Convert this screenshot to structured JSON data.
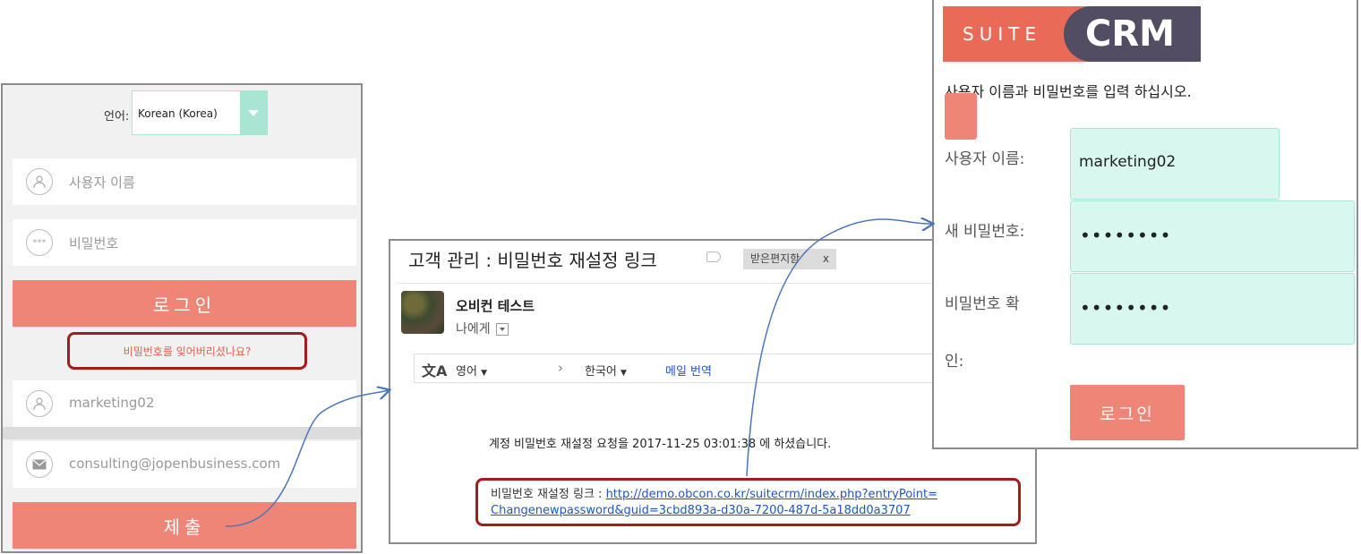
{
  "login": {
    "language_label": "언어:",
    "language_value": "Korean (Korea)",
    "username_placeholder": "사용자 이름",
    "password_placeholder": "비밀번호",
    "login_button": "로그인",
    "forgot_link": "비밀번호를 잊어버리셨나요?",
    "username_value": "marketing02",
    "email_value": "consulting@jopenbusiness.com",
    "submit_button": "제출",
    "icons": {
      "user": "user-icon",
      "password": "password-icon",
      "email": "envelope-icon"
    },
    "accent_color": "#ef8576"
  },
  "email": {
    "subject": "고객 관리 : 비밀번호 재설정 링크",
    "inbox_label": "받은편지함",
    "inbox_close": "x",
    "sender": "오비컨 테스트",
    "recipient": "나에게",
    "translate_from": "영어",
    "translate_to": "한국어",
    "translate_link": "메일 번역",
    "body": "계정 비밀번호 재설정 요청을 2017-11-25 03:01:38 에 하셨습니다.",
    "link_prefix": "비밀번호 재설정 링크 : ",
    "link_part1": "http://demo.obcon.co.kr/suitecrm/index.php?entryPoint=",
    "link_part2": "Changenewpassword&guid=3cbd893a-d30a-7200-487d-5a18dd0a3707"
  },
  "suitecrm": {
    "logo_suite": "SUITE",
    "logo_crm": "CRM",
    "instruction": "사용자 이름과 비밀번호를 입력 하십시오.",
    "username_label": "사용자 이름:",
    "username_value": "marketing02",
    "new_password_label": "새 비밀번호:",
    "new_password_value": "••••••••",
    "confirm_label_1": "비밀번호 확",
    "confirm_label_2": "인:",
    "confirm_value": "••••••••",
    "login_button": "로그인"
  }
}
